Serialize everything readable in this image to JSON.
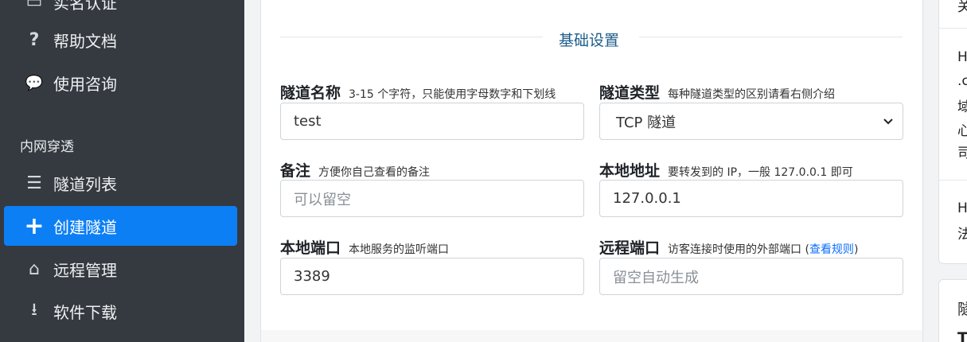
{
  "sidebar": {
    "items": [
      {
        "icon": "id-card-icon",
        "glyph": "▭",
        "label": "实名认证"
      },
      {
        "icon": "question-icon",
        "glyph": "?",
        "label": "帮助文档"
      },
      {
        "icon": "chat-icon",
        "glyph": "💬",
        "label": "使用咨询"
      }
    ],
    "section_header": "内网穿透",
    "section_items": [
      {
        "icon": "list-icon",
        "glyph": "☰",
        "label": "隧道列表"
      },
      {
        "icon": "plus-icon",
        "glyph": "+",
        "label": "创建隧道",
        "active": true
      },
      {
        "icon": "remote-icon",
        "glyph": "⌂",
        "label": "远程管理"
      },
      {
        "icon": "download-icon",
        "glyph": "⭳",
        "label": "软件下载"
      }
    ]
  },
  "form": {
    "section_title": "基础设置",
    "tunnel_name": {
      "label": "隧道名称",
      "help": "3-15 个字符，只能使用字母数字和下划线",
      "value": "test"
    },
    "tunnel_type": {
      "label": "隧道类型",
      "help": "每种隧道类型的区别请看右侧介绍",
      "value": "TCP 隧道"
    },
    "remark": {
      "label": "备注",
      "help": "方便你自己查看的备注",
      "placeholder": "可以留空"
    },
    "local_address": {
      "label": "本地地址",
      "help": "要转发到的 IP，一般 127.0.0.1 即可",
      "value": "127.0.0.1"
    },
    "local_port": {
      "label": "本地端口",
      "help": "本地服务的监听端口",
      "value": "3389"
    },
    "remote_port": {
      "label": "远程端口",
      "help": "访客连接时使用的外部端口 (",
      "link": "查看规则",
      "help_end": ")",
      "placeholder": "留空自动生成"
    }
  },
  "right": {
    "snippets": [
      "关",
      "H",
      ".c",
      "域",
      "心",
      "司",
      "H",
      "法",
      "隧",
      "T"
    ]
  }
}
